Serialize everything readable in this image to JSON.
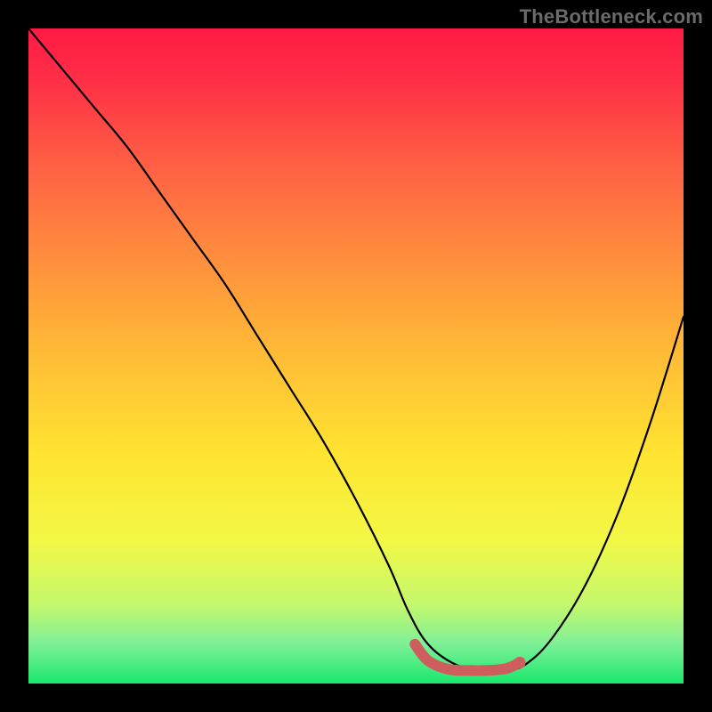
{
  "watermark": "TheBottleneck.com",
  "chart_data": {
    "type": "line",
    "title": "",
    "xlabel": "",
    "ylabel": "",
    "xlim": [
      0,
      100
    ],
    "ylim": [
      0,
      100
    ],
    "grid": false,
    "legend": false,
    "gradient_stops": [
      {
        "offset": 0.0,
        "color": "#ff1a45"
      },
      {
        "offset": 0.08,
        "color": "#ff2f46"
      },
      {
        "offset": 0.2,
        "color": "#ff5d44"
      },
      {
        "offset": 0.35,
        "color": "#ff8e3e"
      },
      {
        "offset": 0.5,
        "color": "#ffbc36"
      },
      {
        "offset": 0.65,
        "color": "#ffe431"
      },
      {
        "offset": 0.78,
        "color": "#f3f845"
      },
      {
        "offset": 0.88,
        "color": "#c4f86d"
      },
      {
        "offset": 0.94,
        "color": "#7df096"
      },
      {
        "offset": 1.0,
        "color": "#19e86e"
      }
    ],
    "series": [
      {
        "name": "bottleneck-curve",
        "color": "#000000",
        "x": [
          0,
          5,
          10,
          15,
          20,
          25,
          30,
          35,
          40,
          45,
          50,
          55,
          58,
          61,
          65,
          69,
          73,
          76,
          80,
          85,
          90,
          95,
          100
        ],
        "y": [
          100,
          94,
          88,
          82,
          75,
          68,
          61,
          53,
          45,
          37,
          28,
          18,
          11,
          6,
          3,
          2,
          2,
          3,
          7,
          15,
          26,
          40,
          56
        ]
      }
    ],
    "highlight": {
      "name": "optimal-range",
      "color": "#cf5d5d",
      "width": 12,
      "x": [
        59,
        61,
        64,
        67,
        70,
        73,
        75
      ],
      "y": [
        6,
        3.5,
        2.2,
        2.0,
        2.0,
        2.3,
        3.2
      ]
    }
  }
}
